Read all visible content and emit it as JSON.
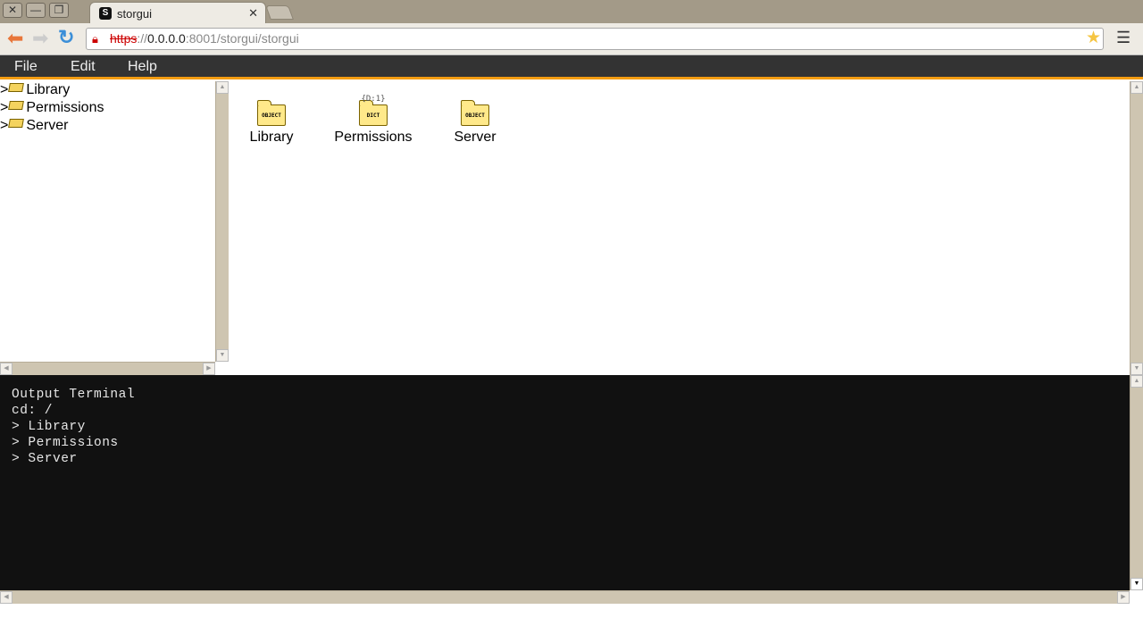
{
  "browser": {
    "tab_title": "storgui",
    "url": {
      "scheme": "https",
      "sep": "://",
      "host": "0.0.0.0",
      "rest": ":8001/storgui/storgui"
    },
    "window_buttons": [
      "close",
      "minimize",
      "restore"
    ]
  },
  "menubar": {
    "items": [
      "File",
      "Edit",
      "Help"
    ]
  },
  "tree": {
    "items": [
      {
        "label": "Library",
        "expander": ">"
      },
      {
        "label": "Permissions",
        "expander": ">"
      },
      {
        "label": "Server",
        "expander": ">"
      }
    ]
  },
  "main": {
    "icons": [
      {
        "label": "Library",
        "type": "OBJECT"
      },
      {
        "label": "Permissions",
        "type": "DICT",
        "sketch": "{D:1}"
      },
      {
        "label": "Server",
        "type": "OBJECT"
      }
    ]
  },
  "terminal": {
    "lines": [
      "Output Terminal",
      "cd: /",
      "> Library",
      "> Permissions",
      "> Server"
    ]
  },
  "colors": {
    "menubar": "#333333",
    "accent": "#f39c12",
    "terminal_bg": "#111111",
    "folder": "#ffe98a"
  }
}
